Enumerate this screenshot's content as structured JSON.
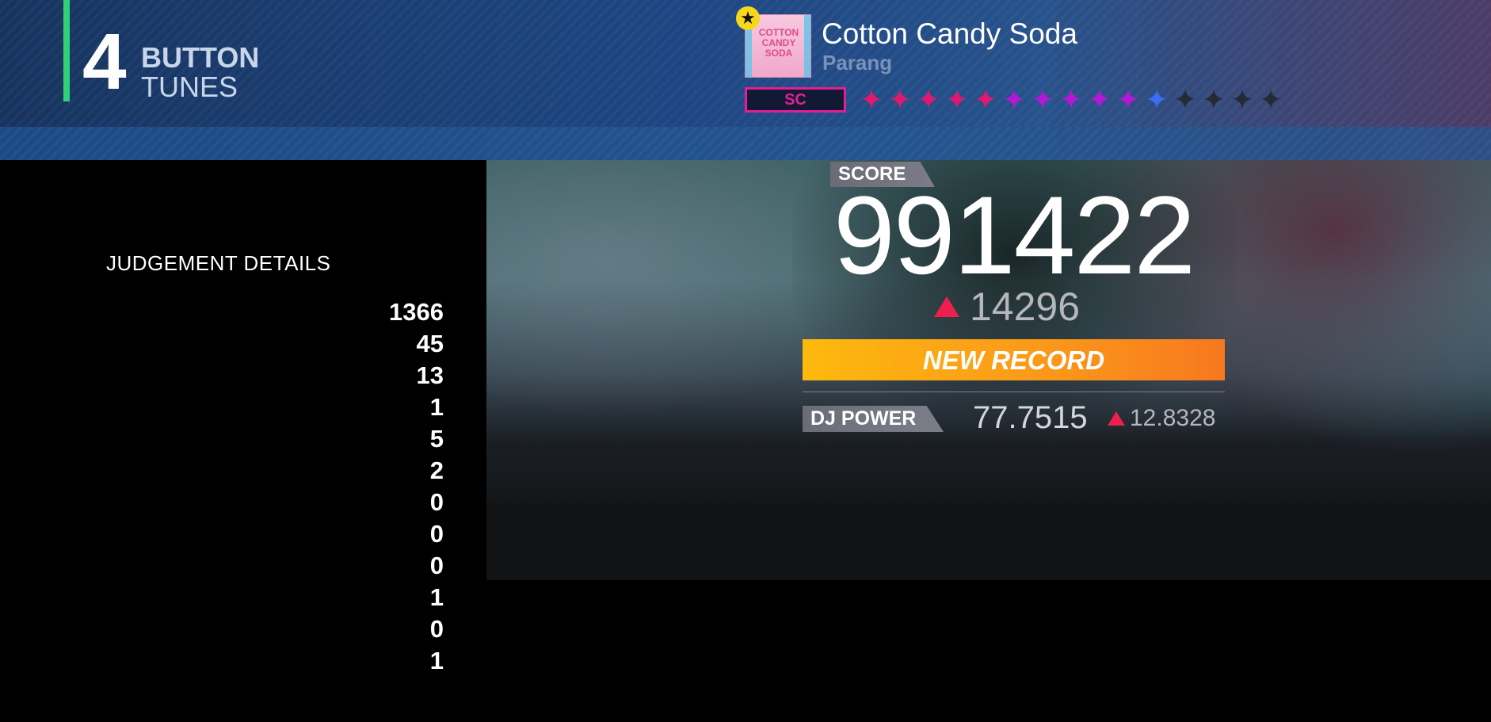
{
  "mode": {
    "number": "4",
    "line1": "BUTTON",
    "line2": "TUNES"
  },
  "song": {
    "title": "Cotton Candy Soda",
    "artist": "Parang",
    "jacket_text": "COTTON CANDY SODA",
    "jacket_icon": "star-badge",
    "difficulty": "SC",
    "level_stars": [
      {
        "color": "#e0196e"
      },
      {
        "color": "#e0196e"
      },
      {
        "color": "#e0196e"
      },
      {
        "color": "#e0196e"
      },
      {
        "color": "#e0196e"
      },
      {
        "color": "#b517d6"
      },
      {
        "color": "#b517d6"
      },
      {
        "color": "#b517d6"
      },
      {
        "color": "#b517d6"
      },
      {
        "color": "#b517d6"
      },
      {
        "color": "#3c6cf0"
      },
      {
        "color": "#262a36"
      },
      {
        "color": "#262a36"
      },
      {
        "color": "#262a36"
      },
      {
        "color": "#262a36"
      }
    ]
  },
  "judgement": {
    "title": "JUDGEMENT DETAILS",
    "values": [
      "1366",
      "45",
      "13",
      "1",
      "5",
      "2",
      "0",
      "0",
      "0",
      "1",
      "0",
      "1"
    ]
  },
  "result": {
    "score_label": "SCORE",
    "score": "991422",
    "score_diff": "14296",
    "new_record": "NEW RECORD",
    "dj_power_label": "DJ POWER",
    "dj_power": "77.7515",
    "dj_power_diff": "12.8328"
  },
  "colors": {
    "accent_green": "#2fd27a",
    "difficulty_pink": "#e41e96",
    "increase_red": "#ee1f4e",
    "record_orange": "#fb9a19"
  }
}
